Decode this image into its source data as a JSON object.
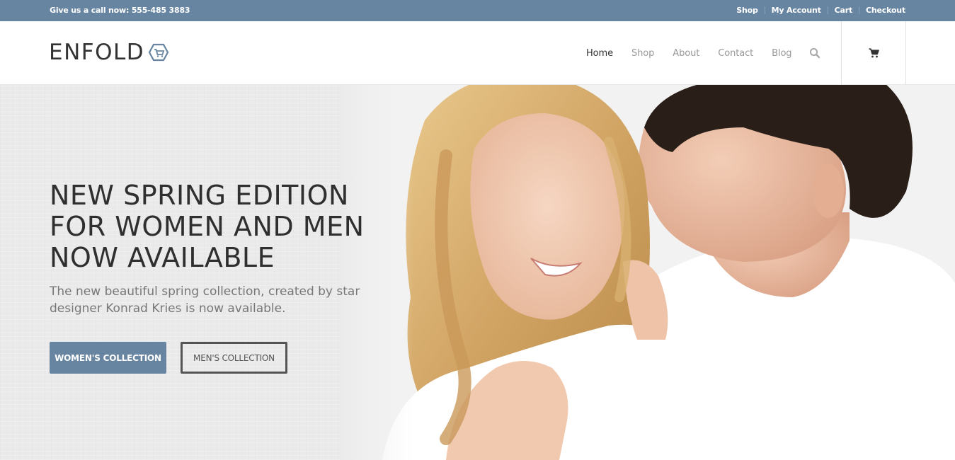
{
  "topbar": {
    "phone_text": "Give us a call now: 555-485 3883",
    "links": [
      "Shop",
      "My Account",
      "Cart",
      "Checkout"
    ]
  },
  "header": {
    "logo_text": "ENFOLD",
    "logo_icon": "hexagon-cart-icon",
    "nav": [
      {
        "label": "Home",
        "active": true
      },
      {
        "label": "Shop",
        "active": false
      },
      {
        "label": "About",
        "active": false
      },
      {
        "label": "Contact",
        "active": false
      },
      {
        "label": "Blog",
        "active": false
      }
    ],
    "search_icon": "search-icon",
    "cart_icon": "cart-icon"
  },
  "hero": {
    "title_lines": [
      "NEW SPRING EDITION",
      "FOR WOMEN AND MEN",
      "NOW AVAILABLE"
    ],
    "subtitle": "The new beautiful spring collection, created by star designer Konrad Kries is now available.",
    "buttons": {
      "primary": "WOMEN'S COLLECTION",
      "secondary": "MEN'S COLLECTION"
    },
    "image": "couple-photo"
  },
  "colors": {
    "accent": "#6785a1",
    "text_dark": "#2f2f2f",
    "text_muted": "#777777",
    "nav_inactive": "#999999"
  }
}
